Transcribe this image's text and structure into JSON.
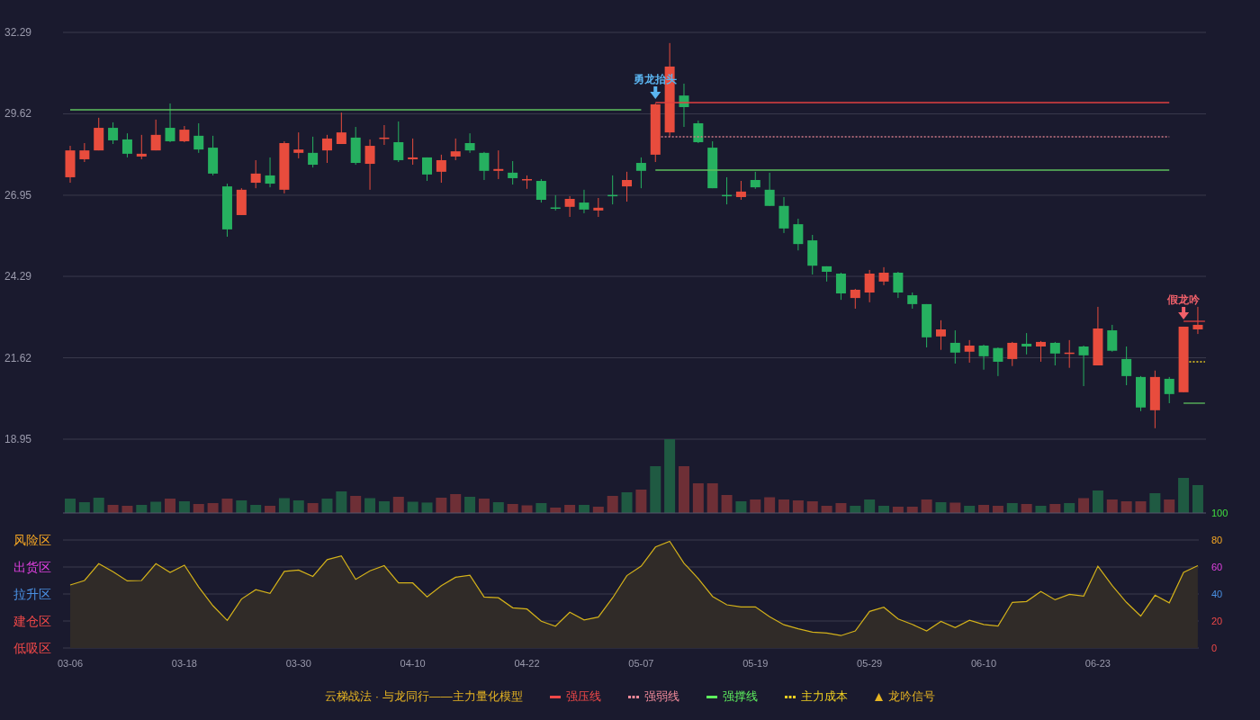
{
  "price_chart": {
    "chart_data": {
      "type": "candlestick",
      "grid": true,
      "ylim": [
        18.95,
        32.29
      ],
      "yticks": [
        18.95,
        21.62,
        24.29,
        26.95,
        29.62,
        32.29
      ],
      "ohlc": [
        [
          27.54,
          28.57,
          27.36,
          28.42
        ],
        [
          28.13,
          28.66,
          28.04,
          28.42
        ],
        [
          28.42,
          29.49,
          28.42,
          29.16
        ],
        [
          29.16,
          29.34,
          28.63,
          28.75
        ],
        [
          28.78,
          28.98,
          28.19,
          28.31
        ],
        [
          28.22,
          28.93,
          28.13,
          28.31
        ],
        [
          28.42,
          29.43,
          28.42,
          28.93
        ],
        [
          29.16,
          29.96,
          28.69,
          28.72
        ],
        [
          28.72,
          29.22,
          28.69,
          29.1
        ],
        [
          28.9,
          29.31,
          28.34,
          28.45
        ],
        [
          28.51,
          28.9,
          27.6,
          27.66
        ],
        [
          27.24,
          27.33,
          25.59,
          25.83
        ],
        [
          26.3,
          27.18,
          26.3,
          27.13
        ],
        [
          27.36,
          28.1,
          27.18,
          27.66
        ],
        [
          27.6,
          28.19,
          27.21,
          27.33
        ],
        [
          27.13,
          28.72,
          27.01,
          28.66
        ],
        [
          28.34,
          29.01,
          28.16,
          28.45
        ],
        [
          28.34,
          28.87,
          27.86,
          27.95
        ],
        [
          28.42,
          28.93,
          28.01,
          28.81
        ],
        [
          28.63,
          29.66,
          28.63,
          29.01
        ],
        [
          28.84,
          29.19,
          27.95,
          28.01
        ],
        [
          27.98,
          28.78,
          27.13,
          28.57
        ],
        [
          28.83,
          29.25,
          28.6,
          28.84
        ],
        [
          28.69,
          29.37,
          28.04,
          28.1
        ],
        [
          28.13,
          28.81,
          27.95,
          28.19
        ],
        [
          28.19,
          28.19,
          27.42,
          27.63
        ],
        [
          27.72,
          28.28,
          27.36,
          28.1
        ],
        [
          28.22,
          28.81,
          28.1,
          28.39
        ],
        [
          28.66,
          28.98,
          28.34,
          28.42
        ],
        [
          28.34,
          28.37,
          27.45,
          27.75
        ],
        [
          27.75,
          28.42,
          27.48,
          27.81
        ],
        [
          27.69,
          28.07,
          27.3,
          27.51
        ],
        [
          27.47,
          27.6,
          27.16,
          27.48
        ],
        [
          27.42,
          27.48,
          26.71,
          26.8
        ],
        [
          26.55,
          26.95,
          26.45,
          26.54
        ],
        [
          26.57,
          26.92,
          26.24,
          26.83
        ],
        [
          26.71,
          27.13,
          26.36,
          26.48
        ],
        [
          26.45,
          26.86,
          26.24,
          26.54
        ],
        [
          26.96,
          27.6,
          26.65,
          26.95
        ],
        [
          27.24,
          27.72,
          26.74,
          27.45
        ],
        [
          28.01,
          28.19,
          27.18,
          27.75
        ],
        [
          28.28,
          29.96,
          28.04,
          29.93
        ],
        [
          29.01,
          31.94,
          28.87,
          31.17
        ],
        [
          30.22,
          30.61,
          29.19,
          29.84
        ],
        [
          29.31,
          29.4,
          28.66,
          28.69
        ],
        [
          28.51,
          28.72,
          27.18,
          27.18
        ],
        [
          26.96,
          27.54,
          26.65,
          26.95
        ],
        [
          26.89,
          27.42,
          26.8,
          27.07
        ],
        [
          27.45,
          27.72,
          27.16,
          27.21
        ],
        [
          27.13,
          27.69,
          26.6,
          26.6
        ],
        [
          26.6,
          26.89,
          25.71,
          25.86
        ],
        [
          26.0,
          26.18,
          25.14,
          25.35
        ],
        [
          25.47,
          25.65,
          24.35,
          24.64
        ],
        [
          24.62,
          24.62,
          24.12,
          24.44
        ],
        [
          24.38,
          24.41,
          23.52,
          23.73
        ],
        [
          23.58,
          23.88,
          23.23,
          23.85
        ],
        [
          23.76,
          24.5,
          23.44,
          24.38
        ],
        [
          24.12,
          24.59,
          24.0,
          24.41
        ],
        [
          24.41,
          24.44,
          23.58,
          23.76
        ],
        [
          23.67,
          23.76,
          23.23,
          23.38
        ],
        [
          23.38,
          23.38,
          21.96,
          22.29
        ],
        [
          22.32,
          22.85,
          21.88,
          22.55
        ],
        [
          22.11,
          22.52,
          21.43,
          21.79
        ],
        [
          21.82,
          22.2,
          21.46,
          22.02
        ],
        [
          22.02,
          22.05,
          21.23,
          21.67
        ],
        [
          21.94,
          21.96,
          21.02,
          21.49
        ],
        [
          21.58,
          22.14,
          21.35,
          22.11
        ],
        [
          22.08,
          22.43,
          21.73,
          21.99
        ],
        [
          21.99,
          22.17,
          21.49,
          22.14
        ],
        [
          22.11,
          22.14,
          21.37,
          21.76
        ],
        [
          21.78,
          22.2,
          21.29,
          21.79
        ],
        [
          21.99,
          22.02,
          20.69,
          21.7
        ],
        [
          21.37,
          23.29,
          21.37,
          22.58
        ],
        [
          22.52,
          22.7,
          21.82,
          21.85
        ],
        [
          21.58,
          21.99,
          20.72,
          21.02
        ],
        [
          20.99,
          21.02,
          19.87,
          19.99
        ],
        [
          19.9,
          21.2,
          19.31,
          20.99
        ],
        [
          20.93,
          20.99,
          20.13,
          20.43
        ],
        [
          20.49,
          22.64,
          20.49,
          22.64
        ],
        [
          22.55,
          23.29,
          22.4,
          22.7
        ]
      ],
      "annotations": [
        "勇龙抬头",
        "假龙吟"
      ]
    }
  },
  "indicator_chart": {
    "zones": [
      {
        "label": "风险区",
        "color": "#f5a623"
      },
      {
        "label": "出货区",
        "color": "#e040e0"
      },
      {
        "label": "拉升区",
        "color": "#4a90e2"
      },
      {
        "label": "建仓区",
        "color": "#f04848"
      },
      {
        "label": "低吸区",
        "color": "#f04848"
      }
    ],
    "chart_data": {
      "type": "area",
      "grid": true,
      "ylim": [
        0,
        100
      ],
      "yticks": [
        0,
        20,
        40,
        60,
        80,
        100
      ],
      "categories": [
        "03-06",
        null,
        null,
        null,
        null,
        null,
        null,
        null,
        "03-18",
        null,
        null,
        null,
        null,
        null,
        null,
        null,
        "03-30",
        null,
        null,
        null,
        null,
        null,
        null,
        null,
        "04-10",
        null,
        null,
        null,
        null,
        null,
        null,
        null,
        "04-22",
        null,
        null,
        null,
        null,
        null,
        null,
        null,
        "05-07",
        null,
        null,
        null,
        null,
        null,
        null,
        null,
        "05-19",
        null,
        null,
        null,
        null,
        null,
        null,
        null,
        "05-29",
        null,
        null,
        null,
        null,
        null,
        null,
        null,
        "06-10",
        null,
        null,
        null,
        null,
        null,
        null,
        null,
        "06-23",
        null,
        null,
        null,
        null,
        null,
        null,
        null
      ],
      "series": [
        {
          "color": "#d4b21a",
          "values": [
            46.7,
            50,
            62.5,
            56.5,
            49.7,
            50,
            62.5,
            56,
            61.3,
            45.2,
            31.3,
            20.5,
            36.3,
            43.2,
            40.5,
            56.8,
            57.7,
            53,
            65.5,
            68.2,
            50.9,
            57.1,
            61,
            48.2,
            48.2,
            37.8,
            46.1,
            52.4,
            53.9,
            37.8,
            37.2,
            29.8,
            28.9,
            19.9,
            16.1,
            26.5,
            20.8,
            22.9,
            37.2,
            53.6,
            60.6,
            74.8,
            79,
            62.8,
            51.4,
            38.2,
            32,
            30.5,
            30.5,
            23.1,
            17.2,
            14.2,
            11.7,
            11.1,
            9.2,
            12.6,
            27.1,
            30.2,
            21.5,
            17.5,
            12.6,
            19.7,
            15.1,
            20.6,
            17.5,
            16.3,
            33.8,
            34.5,
            41.8,
            35.7,
            39.7,
            38.5,
            60.6,
            46.2,
            33.8,
            23.7,
            39.1,
            33.5,
            56,
            61
          ]
        }
      ]
    }
  },
  "legend": {
    "items": [
      {
        "kind": "title",
        "label": "云梯战法 · 与龙同行——主力量化模型",
        "color": "#e6b422"
      },
      {
        "kind": "solid",
        "label": "强压线",
        "color": "#f04848"
      },
      {
        "kind": "dashed",
        "label": "强弱线",
        "color": "#f08a9a"
      },
      {
        "kind": "solid",
        "label": "强撑线",
        "color": "#5ef05e"
      },
      {
        "kind": "dashed",
        "label": "主力成本",
        "color": "#f0d020"
      },
      {
        "kind": "triangle",
        "label": "龙吟信号",
        "color": "#e6b422"
      }
    ]
  }
}
